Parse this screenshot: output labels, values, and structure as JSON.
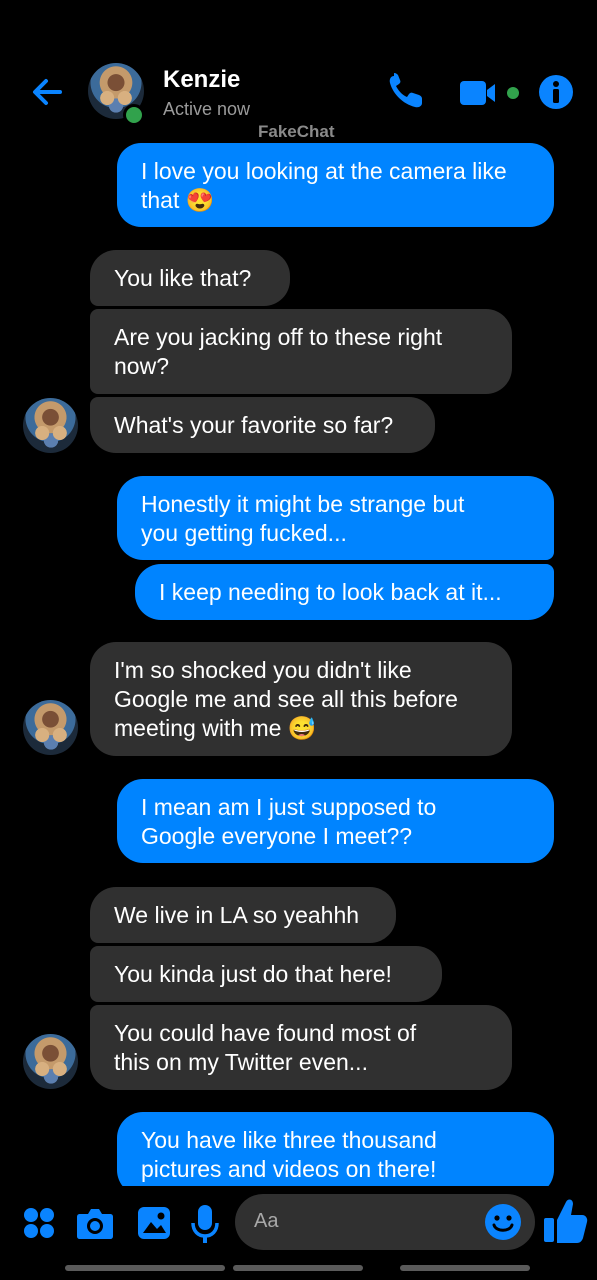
{
  "header": {
    "contact_name": "Kenzie",
    "status": "Active now",
    "watermark": "FakeChat",
    "icons": [
      "back-arrow-icon",
      "phone-icon",
      "video-camera-icon",
      "info-icon"
    ]
  },
  "messages": [
    {
      "side": "out",
      "lines": [
        "I love you looking at the camera like",
        "that 😍"
      ]
    },
    {
      "side": "in",
      "lines": [
        "You like that?"
      ]
    },
    {
      "side": "in",
      "lines": [
        "Are you jacking off to these right",
        "now?"
      ]
    },
    {
      "side": "in",
      "lines": [
        "What's your favorite so far?"
      ]
    },
    {
      "side": "out",
      "lines": [
        "Honestly it might be strange but",
        "you getting fucked..."
      ]
    },
    {
      "side": "out",
      "lines": [
        "I keep needing to look back at it..."
      ]
    },
    {
      "side": "in",
      "lines": [
        "I'm so shocked you didn't like",
        "Google me and see all this before",
        "meeting with me 😅"
      ]
    },
    {
      "side": "out",
      "lines": [
        "I mean am I just supposed to",
        "Google everyone I meet??"
      ]
    },
    {
      "side": "in",
      "lines": [
        "We live in LA so yeahhh"
      ]
    },
    {
      "side": "in",
      "lines": [
        "You kinda just do that here!"
      ]
    },
    {
      "side": "in",
      "lines": [
        "You could have found most of",
        "this on my Twitter even..."
      ]
    },
    {
      "side": "out",
      "lines": [
        "You have like three thousand",
        "pictures and videos on there!"
      ]
    }
  ],
  "composer": {
    "placeholder": "Aa",
    "icons": [
      "apps-grid-icon",
      "camera-icon",
      "gallery-icon",
      "microphone-icon",
      "emoji-icon",
      "thumbs-up-icon"
    ]
  },
  "colors": {
    "accent": "#0084ff",
    "incoming_bubble": "#303030",
    "background": "#000000",
    "online": "#31a24c"
  }
}
